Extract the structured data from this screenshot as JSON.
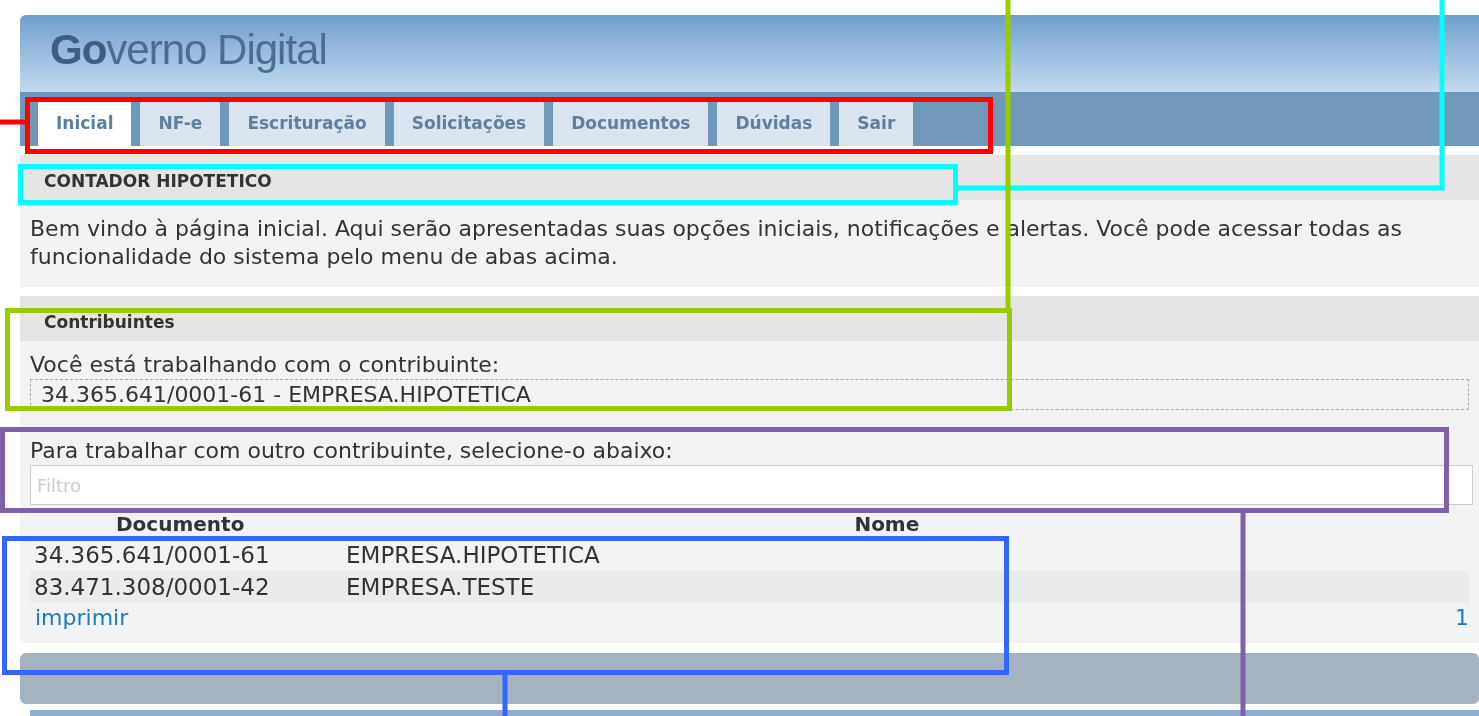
{
  "header": {
    "title": "**Go**verno Digital"
  },
  "tabs": [
    {
      "label": "Inicial",
      "selected": true
    },
    {
      "label": "NF-e",
      "selected": false
    },
    {
      "label": "Escrituração",
      "selected": false
    },
    {
      "label": "Solicitações",
      "selected": false
    },
    {
      "label": "Documentos",
      "selected": false
    },
    {
      "label": "Dúvidas",
      "selected": false
    },
    {
      "label": "Sair",
      "selected": false
    }
  ],
  "welcome": {
    "heading": "CONTADOR HIPOTETICO",
    "text": "Bem vindo à página inicial. Aqui serão apresentadas suas opções iniciais, notificações e alertas. Você pode acessar todas as funcionalidade do sistema pelo menu de abas acima."
  },
  "contribuintes": {
    "heading": "Contribuintes",
    "current_label": "Você está trabalhando com o contribuinte:",
    "current_value": "34.365.641/0001-61 - EMPRESA.HIPOTETICA",
    "select_label": "Para trabalhar com outro contribuinte, selecione-o abaixo:",
    "filter": {
      "placeholder": "Filtro"
    },
    "table": {
      "columns": [
        "Documento",
        "Nome"
      ],
      "rows": [
        {
          "documento": "34.365.641/0001-61",
          "nome": "EMPRESA.HIPOTETICA"
        },
        {
          "documento": "83.471.308/0001-42",
          "nome": "EMPRESA.TESTE"
        }
      ]
    },
    "print_link": "imprimir",
    "page": "1"
  },
  "annotations": [
    {
      "color": "#ff0000"
    },
    {
      "color": "#00ffff"
    },
    {
      "color": "#99cc00"
    },
    {
      "color": "#8060a8"
    },
    {
      "color": "#3366ff"
    }
  ]
}
